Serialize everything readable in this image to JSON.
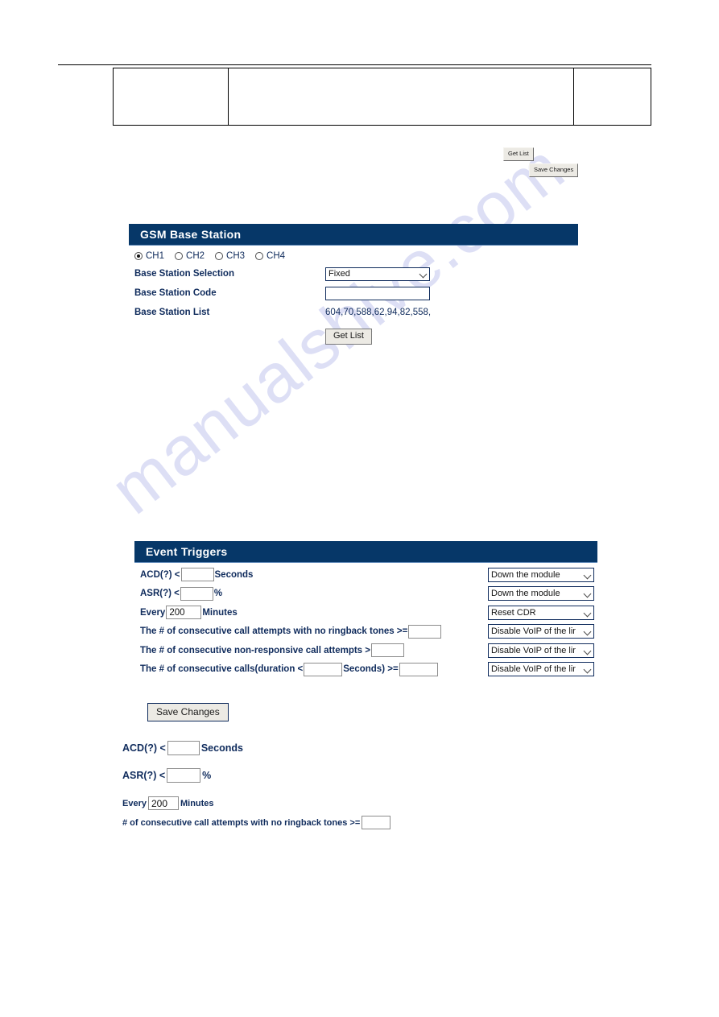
{
  "header_table": {
    "cells": [
      "",
      "",
      ""
    ]
  },
  "top_buttons": {
    "get_list": "Get List",
    "save_changes": "Save Changes"
  },
  "gsm_panel": {
    "title": "GSM Base Station",
    "channels": [
      {
        "label": "CH1",
        "selected": true
      },
      {
        "label": "CH2",
        "selected": false
      },
      {
        "label": "CH3",
        "selected": false
      },
      {
        "label": "CH4",
        "selected": false
      }
    ],
    "selection_label": "Base Station Selection",
    "selection_value": "Fixed",
    "code_label": "Base Station Code",
    "code_value": "",
    "list_label": "Base Station List",
    "list_value": "604,70,588,62,94,82,558,",
    "get_list_button": "Get List"
  },
  "event_panel": {
    "title": "Event Triggers",
    "rows": [
      {
        "pre": "ACD(?) <",
        "value": "",
        "post": "Seconds",
        "action": "Down the module"
      },
      {
        "pre": "ASR(?) <",
        "value": "",
        "post": "%",
        "action": "Down the module"
      },
      {
        "pre": "Every",
        "value": "200",
        "post": "Minutes",
        "action": "Reset CDR"
      },
      {
        "pre": "The # of consecutive call attempts with no ringback tones >=",
        "value": "",
        "post": "",
        "action": "Disable VoIP of the lir"
      },
      {
        "pre": "The # of consecutive non-responsive call attempts >",
        "value": "",
        "post": "",
        "action": "Disable VoIP of the lir"
      },
      {
        "pre": "The # of consecutive calls(duration <",
        "value": "",
        "mid": "Seconds) >=",
        "value2": "",
        "post": "",
        "action": "Disable VoIP of the lir"
      }
    ],
    "save_button": "Save Changes"
  },
  "standalone": {
    "acd_pre": "ACD(?) <",
    "acd_value": "",
    "acd_post": "Seconds",
    "asr_pre": "ASR(?) <",
    "asr_value": "",
    "asr_post": "%",
    "every_pre": "Every",
    "every_value": "200",
    "every_post": "Minutes",
    "ringback_text": "# of consecutive call attempts with no ringback tones >=",
    "ringback_value": ""
  },
  "watermark": {
    "text": "manualshive.com"
  },
  "colors": {
    "panel_header": "#063768",
    "label_text": "#0f2b5c",
    "watermark": "#c9cdf0"
  }
}
